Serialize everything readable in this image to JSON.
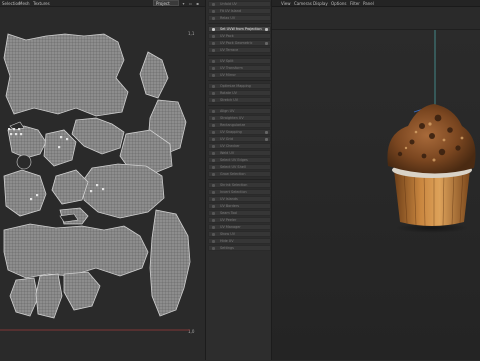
{
  "uv_editor": {
    "menu": [
      "Selection",
      "Mesh",
      "Textures"
    ],
    "dropdown_value": "Project",
    "corner_top_right": "1,1",
    "corner_bottom_right": "1,0"
  },
  "tools": {
    "items": [
      {
        "label": "Unfold UV"
      },
      {
        "label": "Fit UV Island"
      },
      {
        "label": "Relax UV"
      },
      {
        "label": "Set UVW from Projection"
      },
      {
        "label": "UV Pack"
      },
      {
        "label": "UV Pack Geometric"
      },
      {
        "label": "UV Terrace"
      },
      {
        "label": "UV Split"
      },
      {
        "label": "UV Transform"
      },
      {
        "label": "UV Mirror"
      },
      {
        "label": "Optimize Mapping"
      },
      {
        "label": "Rotate UV"
      },
      {
        "label": "Stretch UV"
      },
      {
        "label": "Align UV"
      },
      {
        "label": "Straighten UV"
      },
      {
        "label": "Rectangularize"
      },
      {
        "label": "UV Snapping"
      },
      {
        "label": "UV Grid"
      },
      {
        "label": "UV Checker"
      },
      {
        "label": "Weld UV"
      },
      {
        "label": "Select UV Edges"
      },
      {
        "label": "Select UV Shell"
      },
      {
        "label": "Grow Selection"
      },
      {
        "label": "Shrink Selection"
      },
      {
        "label": "Invert Selection"
      },
      {
        "label": "UV Islands"
      },
      {
        "label": "UV Borders"
      },
      {
        "label": "Seam Tool"
      },
      {
        "label": "UV Peeler"
      },
      {
        "label": "UV Manager"
      },
      {
        "label": "Show UV"
      },
      {
        "label": "Hide UV"
      },
      {
        "label": "Settings"
      }
    ]
  },
  "viewport": {
    "menu": [
      "View",
      "Cameras",
      "Display",
      "Options",
      "Filter",
      "Panel"
    ]
  }
}
